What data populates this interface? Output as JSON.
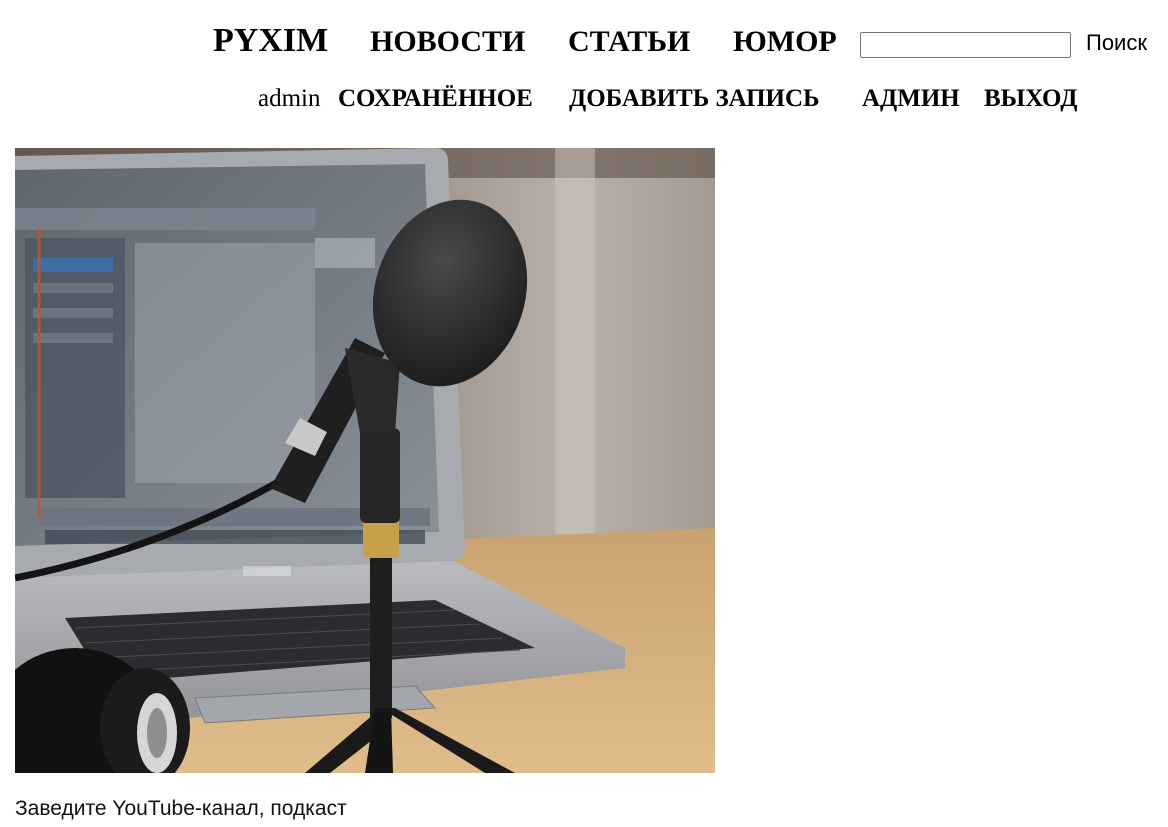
{
  "header": {
    "brand": "PYXIM",
    "nav": {
      "news": "НОВОСТИ",
      "articles": "СТАТЬИ",
      "humor": "ЮМОР"
    },
    "search": {
      "value": "",
      "placeholder": "",
      "button_label": "Поиск"
    },
    "user_nav": {
      "username": "admin",
      "saved": "СОХРАНЁННОЕ",
      "add_post": "ДОБАВИТЬ ЗАПИСЬ",
      "admin": "АДМИН",
      "logout": "ВЫХОД"
    }
  },
  "post": {
    "image_icon": "podcast-microphone-laptop-photo",
    "caption": "Заведите YouTube-канал, подкаст"
  }
}
